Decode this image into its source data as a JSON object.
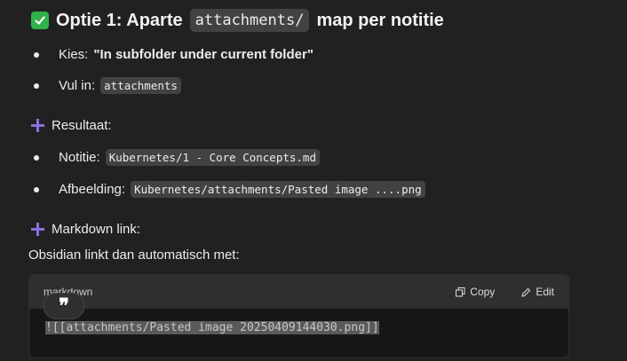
{
  "heading": {
    "prefix": "Optie 1: Aparte",
    "code": "attachments/",
    "suffix": "map per notitie"
  },
  "option_bullets": [
    {
      "label": "Kies:",
      "value": "\"In subfolder under current folder\""
    },
    {
      "label": "Vul in:",
      "code": "attachments"
    }
  ],
  "result_section": {
    "title": "Resultaat:",
    "items": [
      {
        "label": "Notitie:",
        "code": "Kubernetes/1 - Core Concepts.md"
      },
      {
        "label": "Afbeelding:",
        "code": "Kubernetes/attachments/Pasted image ....png"
      }
    ]
  },
  "markdown_section": {
    "title": "Markdown link:"
  },
  "paragraph": "Obsidian linkt dan automatisch met:",
  "code_block": {
    "language": "markdown",
    "copy_label": "Copy",
    "edit_label": "Edit",
    "content": "![[attachments/Pasted image 20250409144030.png]]"
  },
  "quote_button": {
    "glyph": "❞"
  },
  "colors": {
    "check": "#2fb24c",
    "plus": "#8b6fe0",
    "background": "#212121"
  }
}
